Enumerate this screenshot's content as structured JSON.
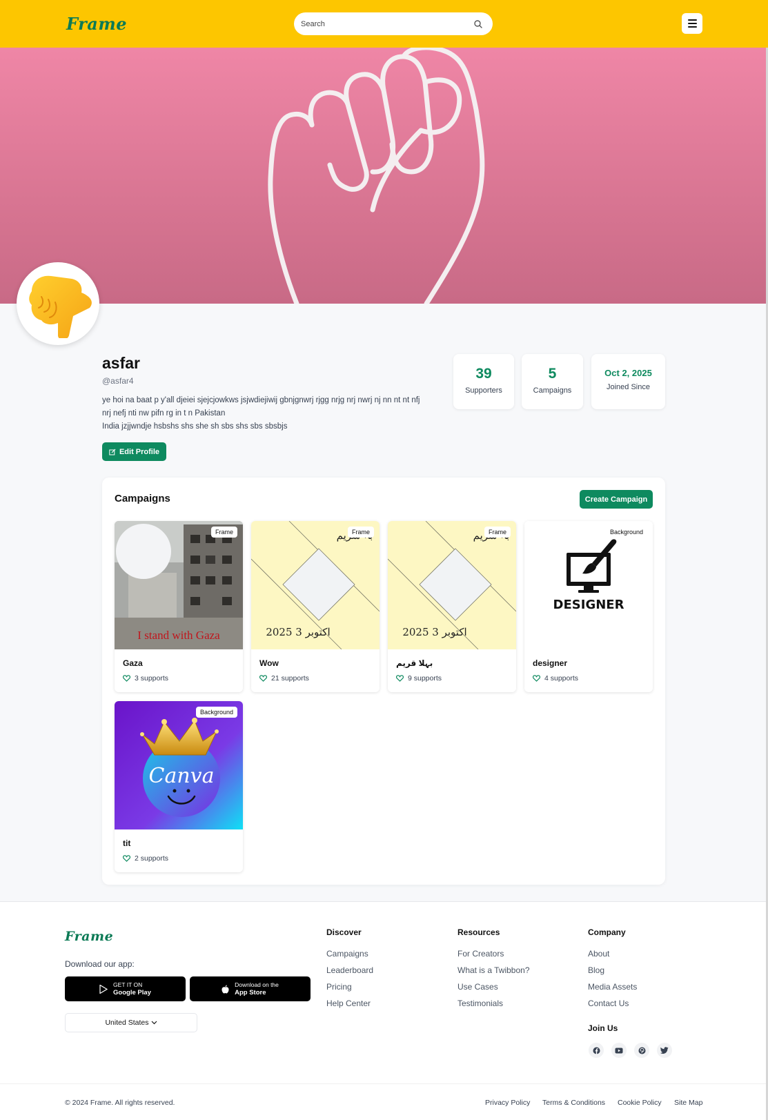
{
  "header": {
    "logo": "Frame",
    "search_placeholder": "Search"
  },
  "profile": {
    "name": "asfar",
    "handle": "@asfar4",
    "bio_line1": "ye hoi na baat p y'all djeiei sjejcjowkws jsjwdiejiwij gbnjgnwrj rjgg nrjg nrj nwrj nj nn nt nt nfj",
    "bio_line2": "nrj nefj nti nw pifn rg in t n Pakistan",
    "bio_line3": "India jzjjwndje hsbshs shs she sh sbs shs sbs sbsbjs",
    "edit_label": "Edit Profile"
  },
  "stats": [
    {
      "value": "39",
      "label": "Supporters"
    },
    {
      "value": "5",
      "label": "Campaigns"
    },
    {
      "value": "Oct 2, 2025",
      "label": "Joined Since"
    }
  ],
  "campaigns": {
    "title": "Campaigns",
    "create_label": "Create Campaign",
    "items": [
      {
        "name": "Gaza",
        "badge": "Frame",
        "supports": "3 supports",
        "overlay_text": "I stand with Gaza"
      },
      {
        "name": "Wow",
        "badge": "Frame",
        "supports": "21 supports",
        "top_text": "بہ شریم",
        "date_text": "2025 3 اکتوبر"
      },
      {
        "name": "بہلا قریم",
        "badge": "Frame",
        "supports": "9 supports",
        "top_text": "بہ شریم",
        "date_text": "2025 3 اکتوبر"
      },
      {
        "name": "designer",
        "badge": "Background",
        "supports": "4 supports",
        "image_text": "DESIGNER"
      },
      {
        "name": "tit",
        "badge": "Background",
        "supports": "2 supports",
        "image_text": "Canva"
      }
    ]
  },
  "footer": {
    "logo": "Frame",
    "download_label": "Download our app:",
    "google_small": "GET IT ON",
    "google_big": "Google Play",
    "apple_small": "Download on the",
    "apple_big": "App Store",
    "country": "United States",
    "discover": {
      "title": "Discover",
      "links": [
        "Campaigns",
        "Leaderboard",
        "Pricing",
        "Help Center"
      ]
    },
    "resources": {
      "title": "Resources",
      "links": [
        "For Creators",
        "What is a Twibbon?",
        "Use Cases",
        "Testimonials"
      ]
    },
    "company": {
      "title": "Company",
      "links": [
        "About",
        "Blog",
        "Media Assets",
        "Contact Us"
      ]
    },
    "join_title": "Join Us",
    "socials": [
      "facebook-icon",
      "youtube-icon",
      "pinterest-icon",
      "twitter-icon"
    ],
    "copyright": "© 2024 Frame. All rights reserved.",
    "bottom_links": [
      "Privacy Policy",
      "Terms & Conditions",
      "Cookie Policy",
      "Site Map"
    ]
  },
  "colors": {
    "header": "#fdc600",
    "accent": "#0e8a5f",
    "banner": "#e17f9c"
  }
}
